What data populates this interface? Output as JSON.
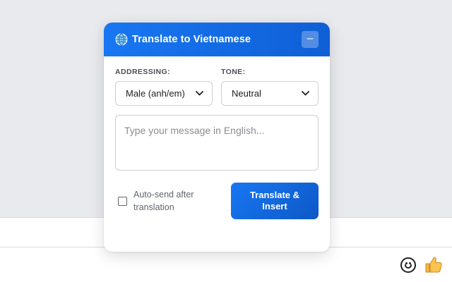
{
  "header": {
    "title": "Translate to Vietnamese",
    "minimize_label": "–"
  },
  "fields": {
    "addressing": {
      "label": "ADDRESSING:",
      "value": "Male (anh/em)"
    },
    "tone": {
      "label": "TONE:",
      "value": "Neutral"
    }
  },
  "message": {
    "placeholder": "Type your message in English..."
  },
  "auto_send": {
    "label": "Auto-send after translation",
    "checked": false
  },
  "translate_button": {
    "label": "Translate & Insert"
  },
  "icons": {
    "globe": "globe-icon",
    "chevron": "chevron-down-icon",
    "emoji": "smiley-icon",
    "like": "thumbs-up-icon"
  },
  "colors": {
    "accent": "#1877f2",
    "accent_dark": "#0d58c6",
    "background": "#e9eaee"
  }
}
